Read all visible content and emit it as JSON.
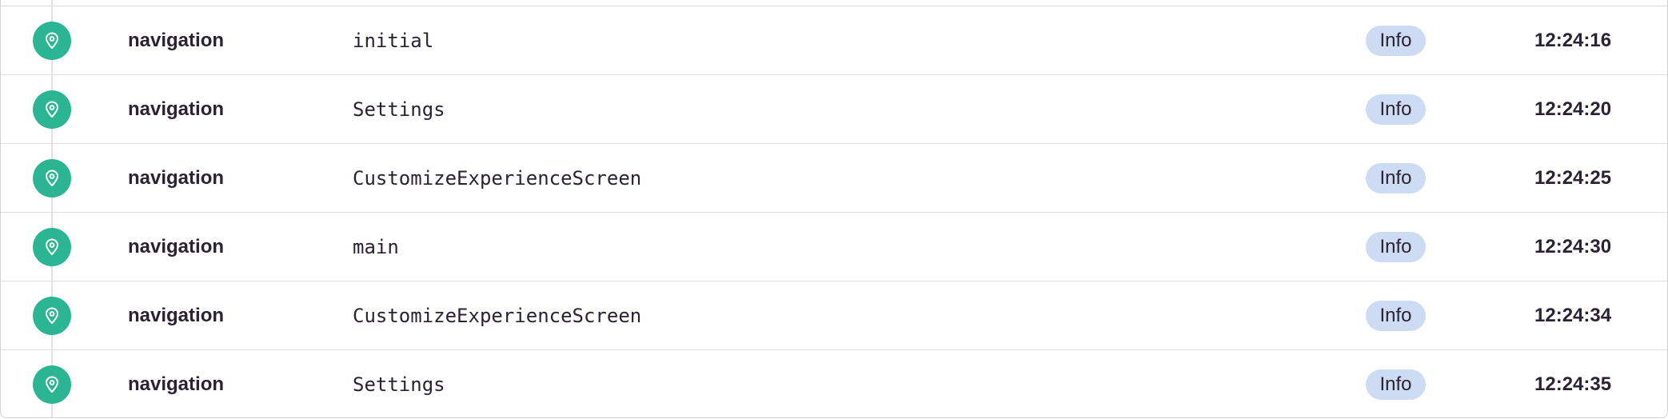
{
  "colors": {
    "icon_background": "#2bb592",
    "level_badge_background": "#cddcf3",
    "text": "#2b2233"
  },
  "breadcrumbs": [
    {
      "icon": "location-pin-icon",
      "category": "navigation",
      "message": "initial",
      "level": "Info",
      "time": "12:24:16"
    },
    {
      "icon": "location-pin-icon",
      "category": "navigation",
      "message": "Settings",
      "level": "Info",
      "time": "12:24:20"
    },
    {
      "icon": "location-pin-icon",
      "category": "navigation",
      "message": "CustomizeExperienceScreen",
      "level": "Info",
      "time": "12:24:25"
    },
    {
      "icon": "location-pin-icon",
      "category": "navigation",
      "message": "main",
      "level": "Info",
      "time": "12:24:30"
    },
    {
      "icon": "location-pin-icon",
      "category": "navigation",
      "message": "CustomizeExperienceScreen",
      "level": "Info",
      "time": "12:24:34"
    },
    {
      "icon": "location-pin-icon",
      "category": "navigation",
      "message": "Settings",
      "level": "Info",
      "time": "12:24:35"
    }
  ]
}
